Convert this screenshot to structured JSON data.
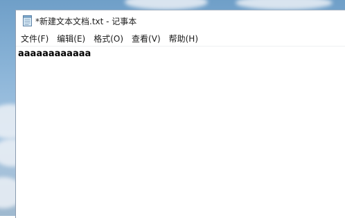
{
  "window": {
    "title": "*新建文本文档.txt - 记事本",
    "icon": "notepad-icon"
  },
  "menu": {
    "items": [
      {
        "label": "文件(F)"
      },
      {
        "label": "编辑(E)"
      },
      {
        "label": "格式(O)"
      },
      {
        "label": "查看(V)"
      },
      {
        "label": "帮助(H)"
      }
    ]
  },
  "editor": {
    "content": "aaaaaaaaaaaa"
  },
  "colors": {
    "window_bg": "#ffffff",
    "text": "#000000",
    "desktop_sky": "#8db6d9"
  }
}
